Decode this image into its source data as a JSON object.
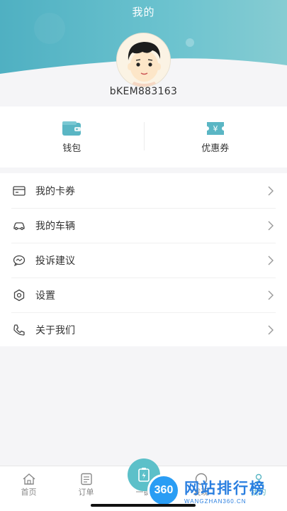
{
  "header": {
    "title": "我的"
  },
  "profile": {
    "username": "bKEM883163"
  },
  "quick_actions": [
    {
      "label": "钱包",
      "icon": "wallet-icon"
    },
    {
      "label": "优惠券",
      "icon": "coupon-icon"
    }
  ],
  "menu": [
    {
      "label": "我的卡券",
      "icon": "card-icon"
    },
    {
      "label": "我的车辆",
      "icon": "car-icon"
    },
    {
      "label": "投诉建议",
      "icon": "chat-icon"
    },
    {
      "label": "设置",
      "icon": "gear-icon"
    },
    {
      "label": "关于我们",
      "icon": "phone-icon"
    }
  ],
  "tabbar": {
    "items": [
      {
        "label": "首页",
        "icon": "home-icon"
      },
      {
        "label": "订单",
        "icon": "order-icon"
      },
      {
        "label": "一键",
        "icon": "charge-icon"
      },
      {
        "label": "发现",
        "icon": "discover-icon"
      },
      {
        "label": "我的",
        "icon": "profile-icon"
      }
    ]
  },
  "watermark": {
    "text": "网站排行榜",
    "sub": "WANGZHAN360.CN",
    "badge": "360"
  },
  "colors": {
    "header": "#5cb8c8",
    "accent": "#5ab6c4"
  }
}
